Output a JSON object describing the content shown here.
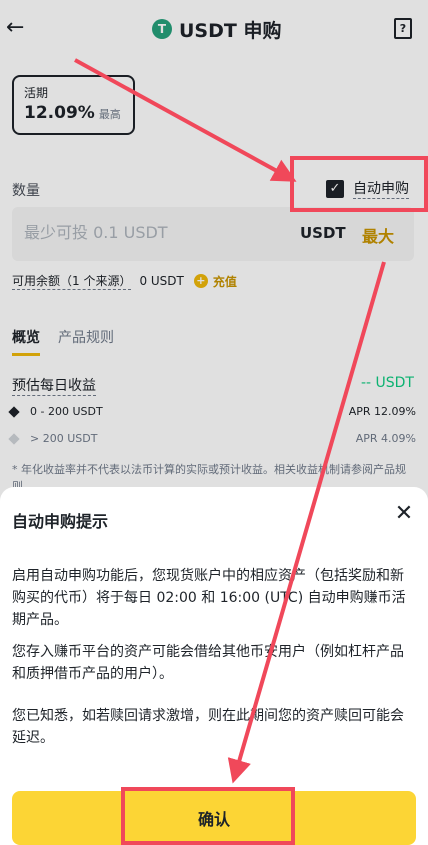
{
  "header": {
    "title": "USDT 申购",
    "coin_glyph": "T",
    "back_glyph": "←",
    "help_glyph": "?"
  },
  "term": {
    "label": "活期",
    "rate": "12.09%",
    "rate_tag": "最高"
  },
  "quantity": {
    "label": "数量",
    "auto_label": "自动申购",
    "auto_checked": true,
    "placeholder": "最少可投 0.1 USDT",
    "unit": "USDT",
    "max": "最大"
  },
  "available": {
    "label": "可用余额（1 个来源）",
    "value": "0 USDT",
    "recharge": "充值"
  },
  "tabs": [
    {
      "label": "概览",
      "active": true
    },
    {
      "label": "产品规则",
      "active": false
    }
  ],
  "estimate": {
    "label": "预估每日收益",
    "value": "-- USDT"
  },
  "tiers": [
    {
      "range": "0 - 200 USDT",
      "apr": "APR 12.09%"
    },
    {
      "range": "> 200 USDT",
      "apr": "APR 4.09%"
    }
  ],
  "disclaimer": "* 年化收益率并不代表以法币计算的实际或预计收益。相关收益机制请参阅产品规则",
  "modal": {
    "title": "自动申购提示",
    "p1": "启用自动申购功能后，您现货账户中的相应资产（包括奖励和新购买的代币）将于每日 02:00 和 16:00 (UTC) 自动申购赚币活期产品。",
    "p2": "您存入赚币平台的资产可能会借给其他币安用户（例如杠杆产品和质押借币产品的用户）。",
    "p3": "您已知悉，如若赎回请求激增，则在此期间您的资产赎回可能会延迟。",
    "confirm": "确认",
    "close_glyph": "✕"
  },
  "colors": {
    "brand": "#fcd535",
    "accent": "#c99400",
    "positive": "#0ecb81",
    "annotation": "#f0485a"
  }
}
